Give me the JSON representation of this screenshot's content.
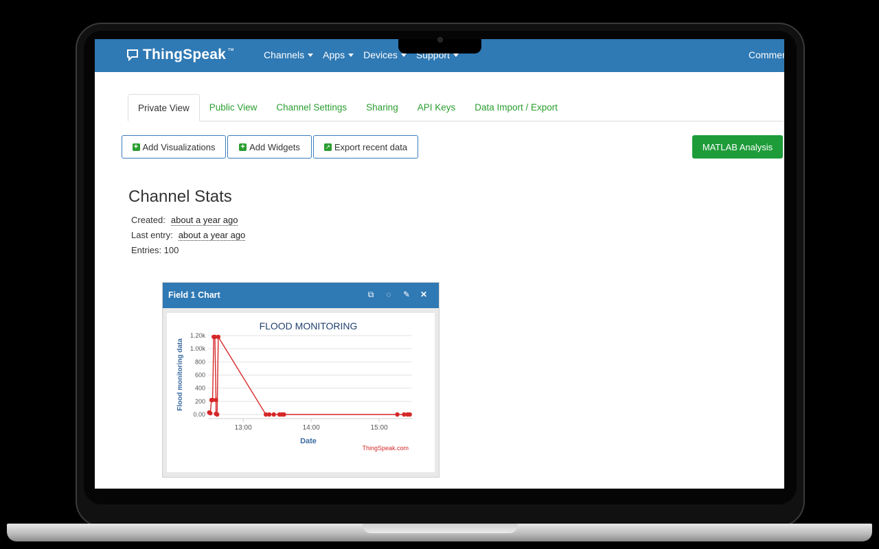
{
  "navbar": {
    "logo": "ThingSpeak",
    "logo_tm": "™",
    "menu": [
      {
        "label": "Channels"
      },
      {
        "label": "Apps"
      },
      {
        "label": "Devices"
      },
      {
        "label": "Support"
      }
    ],
    "right_label": "Commer"
  },
  "tabs": [
    {
      "label": "Private View",
      "active": true
    },
    {
      "label": "Public View"
    },
    {
      "label": "Channel Settings"
    },
    {
      "label": "Sharing"
    },
    {
      "label": "API Keys"
    },
    {
      "label": "Data Import / Export"
    }
  ],
  "actions": {
    "add_visualizations": "Add Visualizations",
    "add_widgets": "Add Widgets",
    "export_recent": "Export recent data",
    "matlab": "MATLAB Analysis"
  },
  "stats": {
    "title": "Channel Stats",
    "created_label": "Created:",
    "created_value": "about a year ago",
    "last_entry_label": "Last entry:",
    "last_entry_value": "about a year ago",
    "entries_label": "Entries: 100"
  },
  "widget": {
    "title": "Field 1 Chart",
    "icons": [
      "external-link-icon",
      "comment-icon",
      "pencil-icon",
      "close-icon"
    ]
  },
  "colors": {
    "navbar": "#2f79b4",
    "tab_link": "#2a9d2f",
    "matlab_button": "#1e9c3a",
    "series": "#d62728",
    "title": "#1f3f6e"
  },
  "chart_data": {
    "type": "line",
    "title": "FLOOD MONITORING",
    "xlabel": "Date",
    "ylabel": "Flood monitoring data",
    "credit": "ThingSpeak.com",
    "ylim": [
      0,
      1200
    ],
    "yticks": [
      0,
      200,
      400,
      600,
      800,
      1000,
      1200
    ],
    "ytick_labels": [
      "0.00",
      "200",
      "400",
      "600",
      "800",
      "1.00k",
      "1.20k"
    ],
    "xticks": [
      "13:00",
      "14:00",
      "15:00"
    ],
    "xlim": [
      "12:29",
      "15:29"
    ],
    "series": [
      {
        "points": [
          [
            "12:30",
            30
          ],
          [
            "12:31",
            20
          ],
          [
            "12:32",
            220
          ],
          [
            "12:33",
            220
          ],
          [
            "12:34",
            1180
          ],
          [
            "12:35",
            1180
          ],
          [
            "12:36",
            220
          ],
          [
            "12:36",
            10
          ],
          [
            "12:37",
            0
          ],
          [
            "12:38",
            1180
          ],
          [
            "13:20",
            0
          ],
          [
            "13:23",
            0
          ],
          [
            "13:27",
            0
          ],
          [
            "13:32",
            0
          ],
          [
            "13:34",
            0
          ],
          [
            "13:36",
            0
          ],
          [
            "15:16",
            0
          ],
          [
            "15:22",
            0
          ],
          [
            "15:25",
            0
          ],
          [
            "15:27",
            0
          ]
        ]
      }
    ]
  }
}
